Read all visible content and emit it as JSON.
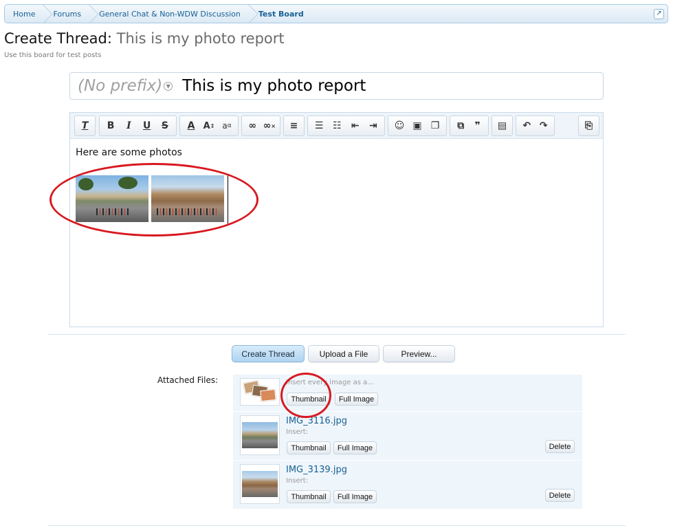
{
  "breadcrumb": {
    "items": [
      "Home",
      "Forums",
      "General Chat & Non-WDW Discussion",
      "Test Board"
    ],
    "jump_icon": "arrow-up-right-icon"
  },
  "page": {
    "title_label": "Create Thread:",
    "title_value": "This is my photo report",
    "subtitle": "Use this board for test posts"
  },
  "thread_title": {
    "prefix": "(No prefix)",
    "value": "This is my photo report"
  },
  "editor": {
    "body_text": "Here are some photos",
    "toolbar_icons": [
      "remove-format-icon",
      "bold-icon",
      "italic-icon",
      "underline-icon",
      "strikethrough-icon",
      "font-color-icon",
      "font-size-icon",
      "font-family-icon",
      "link-icon",
      "unlink-icon",
      "align-icon",
      "bullet-list-icon",
      "numbered-list-icon",
      "outdent-icon",
      "indent-icon",
      "smilie-icon",
      "image-icon",
      "media-icon",
      "code-icon",
      "quote-icon",
      "save-draft-icon",
      "undo-icon",
      "redo-icon",
      "toggle-bbcode-icon"
    ]
  },
  "actions": {
    "create": "Create Thread",
    "upload": "Upload a File",
    "preview": "Preview..."
  },
  "attachments": {
    "label": "Attached Files:",
    "insert_every": "Insert every image as a...",
    "insert": "Insert:",
    "thumbnail": "Thumbnail",
    "full_image": "Full Image",
    "delete": "Delete",
    "files": [
      {
        "name": "IMG_3116.jpg"
      },
      {
        "name": "IMG_3139.jpg"
      }
    ]
  },
  "colors": {
    "link": "#176093",
    "highlight_circle": "#d71920",
    "attachment_bg": "#eef5fb"
  }
}
